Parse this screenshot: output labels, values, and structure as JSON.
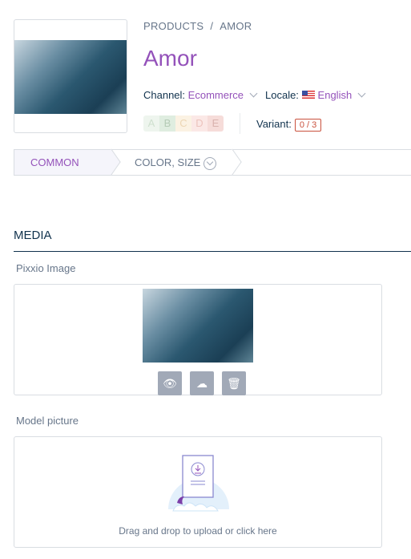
{
  "breadcrumb": {
    "root": "PRODUCTS",
    "separator": "/",
    "current": "AMOR"
  },
  "title": "Amor",
  "channel": {
    "label": "Channel:",
    "value": "Ecommerce"
  },
  "locale": {
    "label": "Locale:",
    "value": "English"
  },
  "grades": [
    {
      "l": "A",
      "bg": "#eef5ee",
      "c": "#cfe0cf"
    },
    {
      "l": "B",
      "bg": "#dfede0",
      "c": "#b5cbb6"
    },
    {
      "l": "C",
      "bg": "#fbf2e3",
      "c": "#ecd6b4"
    },
    {
      "l": "D",
      "bg": "#fbe8e6",
      "c": "#ecc3bd"
    },
    {
      "l": "E",
      "bg": "#f6dcd9",
      "c": "#d9b3ae"
    }
  ],
  "variant": {
    "label": "Variant:",
    "value": "0 / 3"
  },
  "tabs": [
    "COMMON",
    "COLOR, SIZE"
  ],
  "section": "MEDIA",
  "fields": [
    {
      "label": "Pixxio Image"
    },
    {
      "label": "Model picture",
      "drop_text": "Drag and drop to upload or click here"
    }
  ]
}
